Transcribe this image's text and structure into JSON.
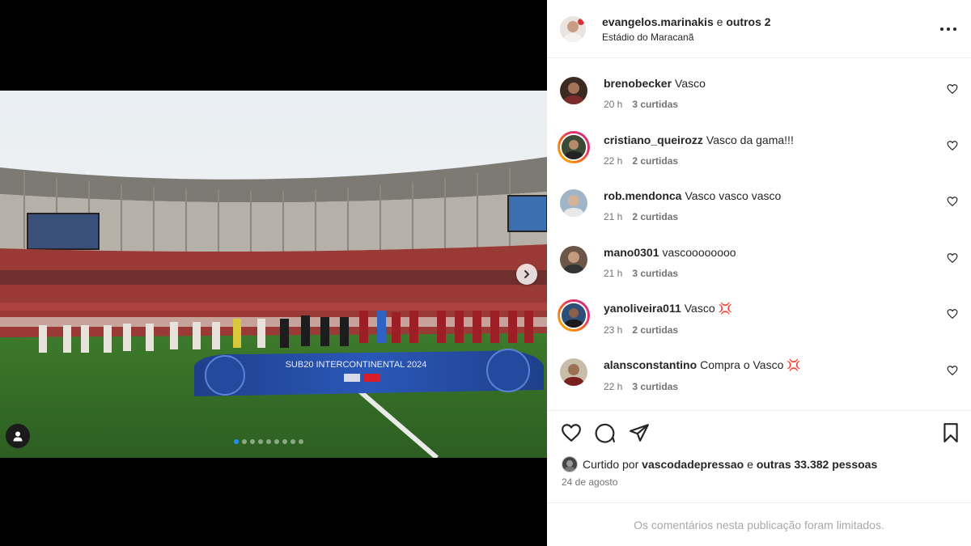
{
  "post": {
    "author": "evangelos.marinakis",
    "joiner": "e",
    "coauthors": "outros 2",
    "location": "Estádio do Maracanã"
  },
  "media": {
    "banner_text": "SUB20 INTERCONTINENTAL 2024",
    "carousel_count": 9,
    "carousel_active_index": 0
  },
  "comments": [
    {
      "user": "brenobecker",
      "text": "Vasco",
      "time": "20 h",
      "likes": "3 curtidas",
      "story_ring": false,
      "avatar_color": "#5a3a2c"
    },
    {
      "user": "cristiano_queirozz",
      "text": "Vasco da gama!!!",
      "time": "22 h",
      "likes": "2 curtidas",
      "story_ring": true,
      "avatar_color": "#3b4a36"
    },
    {
      "user": "rob.mendonca",
      "text": "Vasco vasco vasco",
      "time": "21 h",
      "likes": "2 curtidas",
      "story_ring": false,
      "avatar_color": "#6f8aa0"
    },
    {
      "user": "mano0301",
      "text": "vascoooooooo",
      "time": "21 h",
      "likes": "3 curtidas",
      "story_ring": false,
      "avatar_color": "#8a6d5a"
    },
    {
      "user": "yanoliveira011",
      "text": "Vasco 💢",
      "time": "23 h",
      "likes": "2 curtidas",
      "story_ring": true,
      "avatar_color": "#2d4f7a"
    },
    {
      "user": "alansconstantino",
      "text": "Compra o Vasco 💢",
      "time": "22 h",
      "likes": "3 curtidas",
      "story_ring": false,
      "avatar_color": "#7a5e3a"
    }
  ],
  "actions": {
    "liked_prefix": "Curtido por",
    "liked_user": "vascodadepressao",
    "liked_joiner": "e",
    "liked_others": "outras 33.382 pessoas",
    "date": "24 de agosto",
    "limited_notice": "Os comentários nesta publicação foram limitados."
  },
  "colors": {
    "accent": "#1e90ff",
    "text": "#262626",
    "muted": "#737373",
    "notice": "#a8a8a8"
  },
  "icons": [
    "more-options-icon",
    "heart-icon",
    "comment-icon",
    "share-icon",
    "bookmark-icon",
    "chevron-right-icon",
    "user-tag-icon"
  ]
}
